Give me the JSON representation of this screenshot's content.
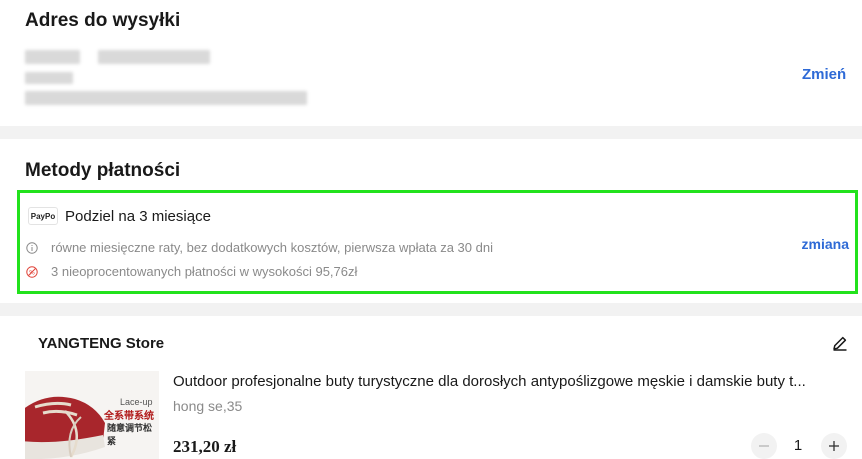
{
  "address": {
    "title": "Adres do wysyłki",
    "change_label": "Zmień"
  },
  "payment": {
    "title": "Metody płatności",
    "logo_text": "PayPo",
    "method_name": "Podziel na 3 miesiące",
    "info_line": "równe miesięczne raty, bez dodatkowych kosztów, pierwsza wpłata za 30 dni",
    "installments_line": "3 nieoprocentowanych płatności w wysokości 95,76zł",
    "change_label": "zmiana",
    "highlight_color": "#22e21c"
  },
  "store": {
    "name": "YANGTENG Store",
    "product": {
      "title": "Outdoor profesjonalne buty turystyczne dla dorosłych antypoślizgowe męskie i damskie buty t...",
      "variant": "hong se,35",
      "price": "231,20 zł",
      "quantity": "1",
      "thumb_text_1": "Lace-up",
      "thumb_text_2": "全系带系统",
      "thumb_text_3": "随意调节松紧"
    }
  },
  "colors": {
    "link": "#2e6ad6",
    "muted": "#8a8a8a",
    "divider": "#f2f2f2"
  }
}
